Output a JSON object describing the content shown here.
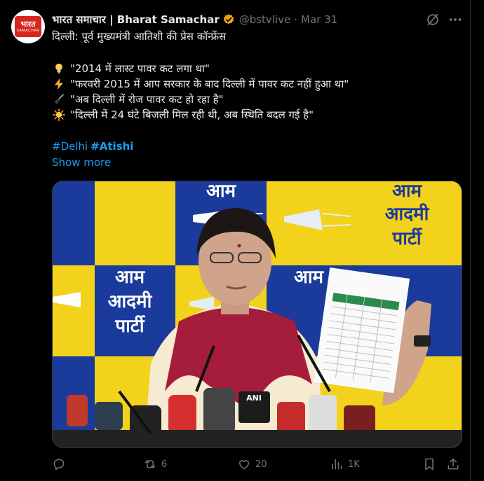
{
  "tweet": {
    "author_name": "भारत समाचार | Bharat Samachar",
    "handle": "@bstvlive",
    "separator": "·",
    "date": "Mar 31",
    "avatar_logo_text": "भारत",
    "avatar_logo_sub": "SAMACHAR",
    "headline": "दिल्ली: पूर्व मुख्यमंत्री आतिशी की प्रेस कॉन्फ्रेंस",
    "bullets": [
      {
        "icon": "lightbulb-icon",
        "text": "\"2014 में लास्ट पावर कट लगा था\""
      },
      {
        "icon": "lightning-icon",
        "text": "\"फरवरी 2015 में आप सरकार के बाद दिल्ली में पावर कट नहीं हुआ था\""
      },
      {
        "icon": "broom-icon",
        "text": "\"अब दिल्ली में रोज पावर कट हो रहा है\""
      },
      {
        "icon": "sun-icon",
        "text": "\"दिल्ली में 24 घंटे बिजली मिल रही थी, अब स्थिति बदल गई है\""
      }
    ],
    "hashtags": [
      "#Delhi",
      "#Atishi"
    ],
    "show_more": "Show more",
    "media_banner": {
      "party_word1": "आम",
      "party_word2": "आदमी",
      "party_word3": "पार्टी",
      "mic_label": "ANI"
    },
    "actions": {
      "replies": "",
      "reposts": "6",
      "likes": "20",
      "views": "1K"
    }
  },
  "colors": {
    "background": "#000000",
    "text": "#e7e9ea",
    "muted": "#71767b",
    "link": "#1d9bf0",
    "aap_yellow": "#f2d21b",
    "aap_blue": "#1a3a9c",
    "verified_gold": "#e8a317"
  }
}
